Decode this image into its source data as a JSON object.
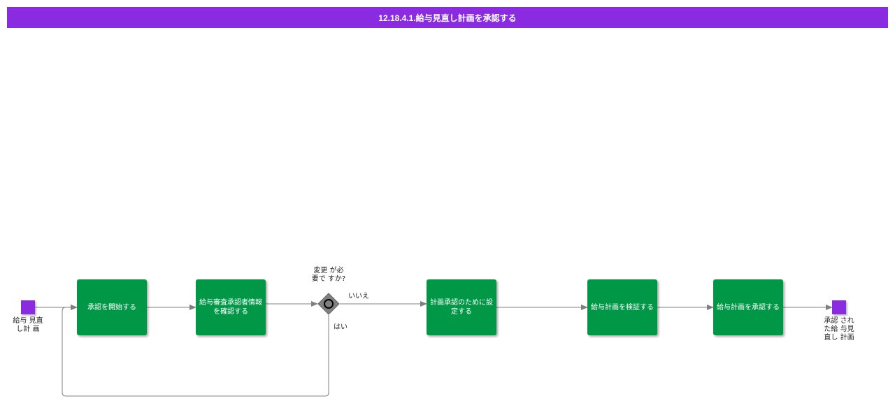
{
  "header": {
    "title": "12.18.4.1.給与見直し計画を承認する"
  },
  "events": {
    "start_label": "給与 見直\nし計 画",
    "end_label": "承認 され\nた給 与見\n直し 計画"
  },
  "tasks": [
    {
      "label": "承認を開始する"
    },
    {
      "label": "給与審査承認者情報を確認する"
    },
    {
      "label": "計画承認のために設定する"
    },
    {
      "label": "給与計画を検証する"
    },
    {
      "label": "給与計画を承認する"
    }
  ],
  "gateway": {
    "question": "変更 が必\n要で すか?",
    "no_label": "いいえ",
    "yes_label": "はい"
  },
  "colors": {
    "header": "#8a2be2",
    "task": "#009846",
    "event": "#8a2be2",
    "gateway": "#808080",
    "connector": "#808080"
  }
}
